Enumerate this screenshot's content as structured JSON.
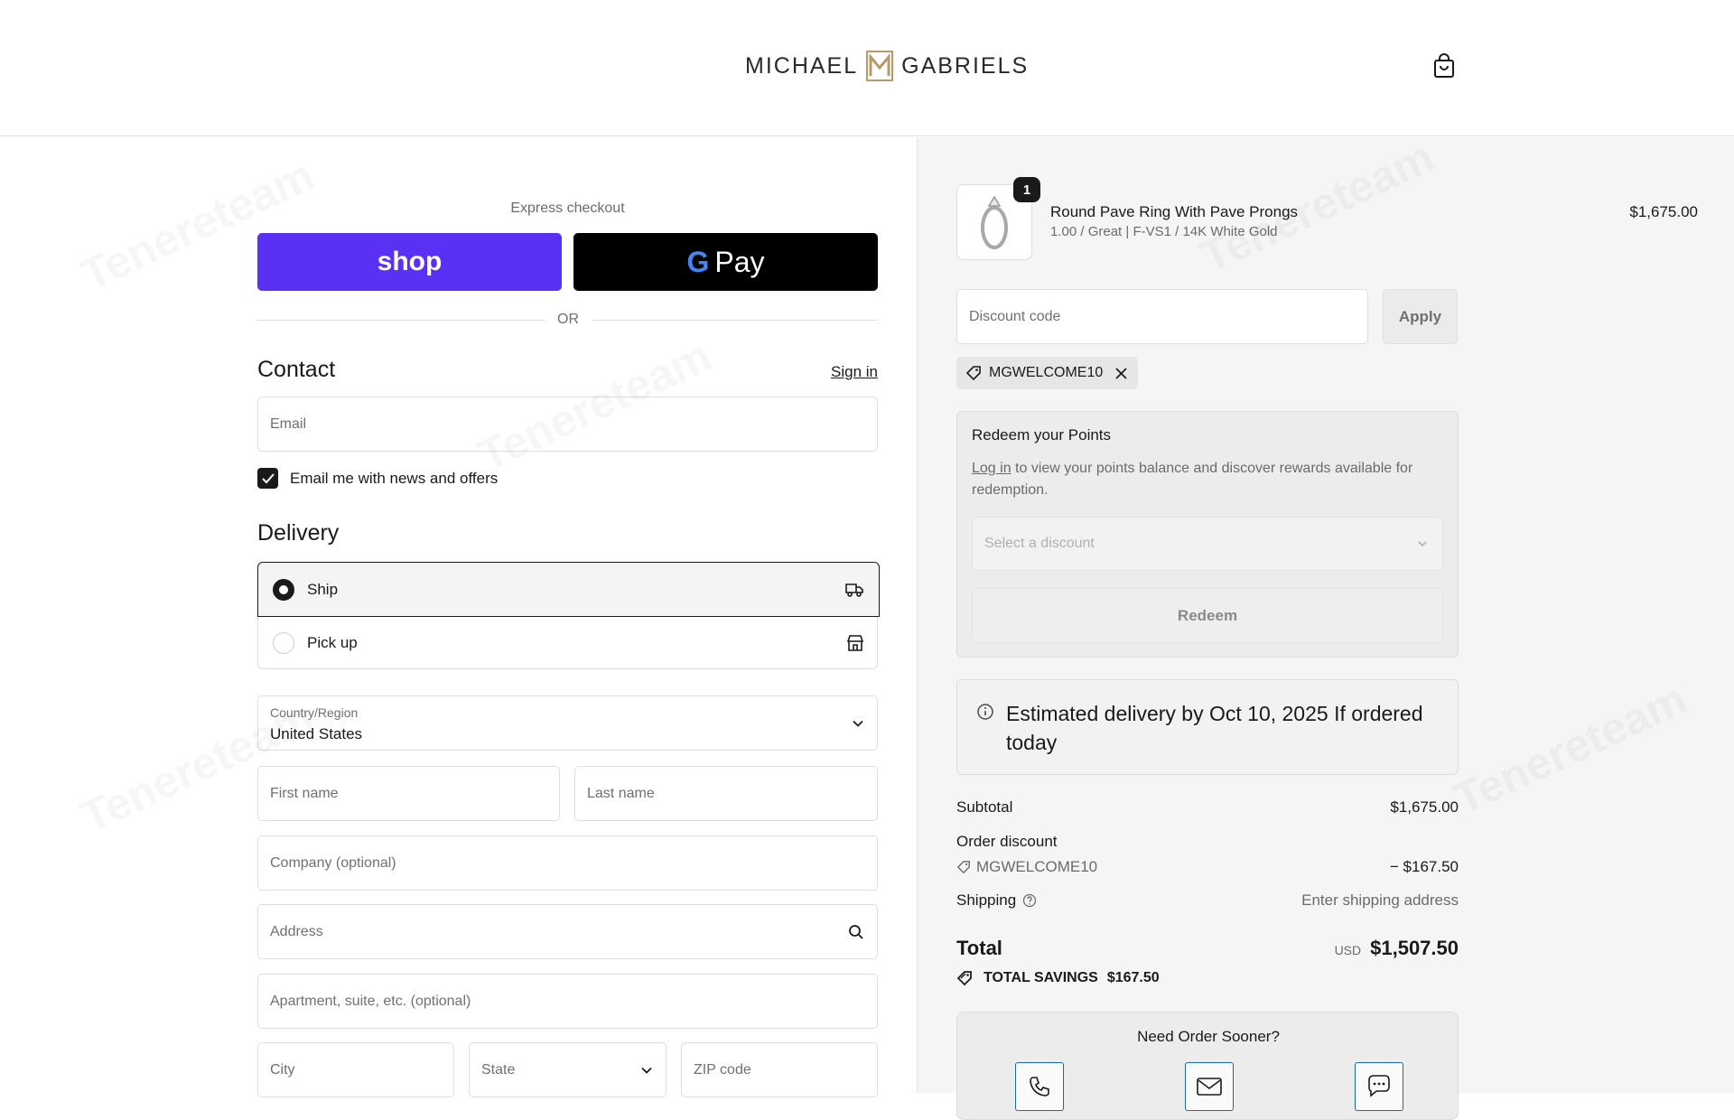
{
  "header": {
    "brand_left": "MICHAEL",
    "brand_right": "GABRIELS",
    "brand_mark": "MG",
    "cart_icon": "shopping-bag-icon"
  },
  "watermark": "Tenereteam",
  "express": {
    "label": "Express checkout",
    "shop_label": "shop",
    "gpay_label": "Pay",
    "gpay_g": "G",
    "or_label": "OR"
  },
  "contact": {
    "title": "Contact",
    "sign_in": "Sign in",
    "email_placeholder": "Email",
    "news_label": "Email me with news and offers",
    "news_checked": true
  },
  "delivery": {
    "title": "Delivery",
    "options": [
      {
        "label": "Ship",
        "selected": true,
        "icon": "truck-icon"
      },
      {
        "label": "Pick up",
        "selected": false,
        "icon": "store-icon"
      }
    ],
    "country_label": "Country/Region",
    "country_value": "United States",
    "first_name": "First name",
    "last_name": "Last name",
    "company": "Company (optional)",
    "address": "Address",
    "apartment": "Apartment, suite, etc. (optional)",
    "city": "City",
    "state": "State",
    "zip": "ZIP code"
  },
  "order": {
    "product": {
      "name": "Round Pave Ring With Pave Prongs",
      "variant": "1.00 / Great | F-VS1 / 14K White Gold",
      "price": "$1,675.00",
      "quantity": "1"
    },
    "discount_placeholder": "Discount code",
    "apply_label": "Apply",
    "applied_code": "MGWELCOME10",
    "redeem": {
      "title": "Redeem your Points",
      "login_link": "Log in",
      "text": " to view your points balance and discover rewards available for redemption.",
      "select_placeholder": "Select a discount",
      "button": "Redeem"
    },
    "eta": "Estimated delivery by Oct 10, 2025 If ordered today",
    "summary": {
      "subtotal_label": "Subtotal",
      "subtotal_value": "$1,675.00",
      "discount_label": "Order discount",
      "discount_code": "MGWELCOME10",
      "discount_value": "− $167.50",
      "shipping_label": "Shipping",
      "shipping_value": "Enter shipping address",
      "total_label": "Total",
      "currency": "USD",
      "total_value": "$1,507.50",
      "savings_label": "TOTAL SAVINGS",
      "savings_value": "$167.50"
    },
    "need_sooner": {
      "title": "Need Order Sooner?",
      "icons": [
        "phone-icon",
        "mail-icon",
        "chat-icon"
      ]
    }
  }
}
